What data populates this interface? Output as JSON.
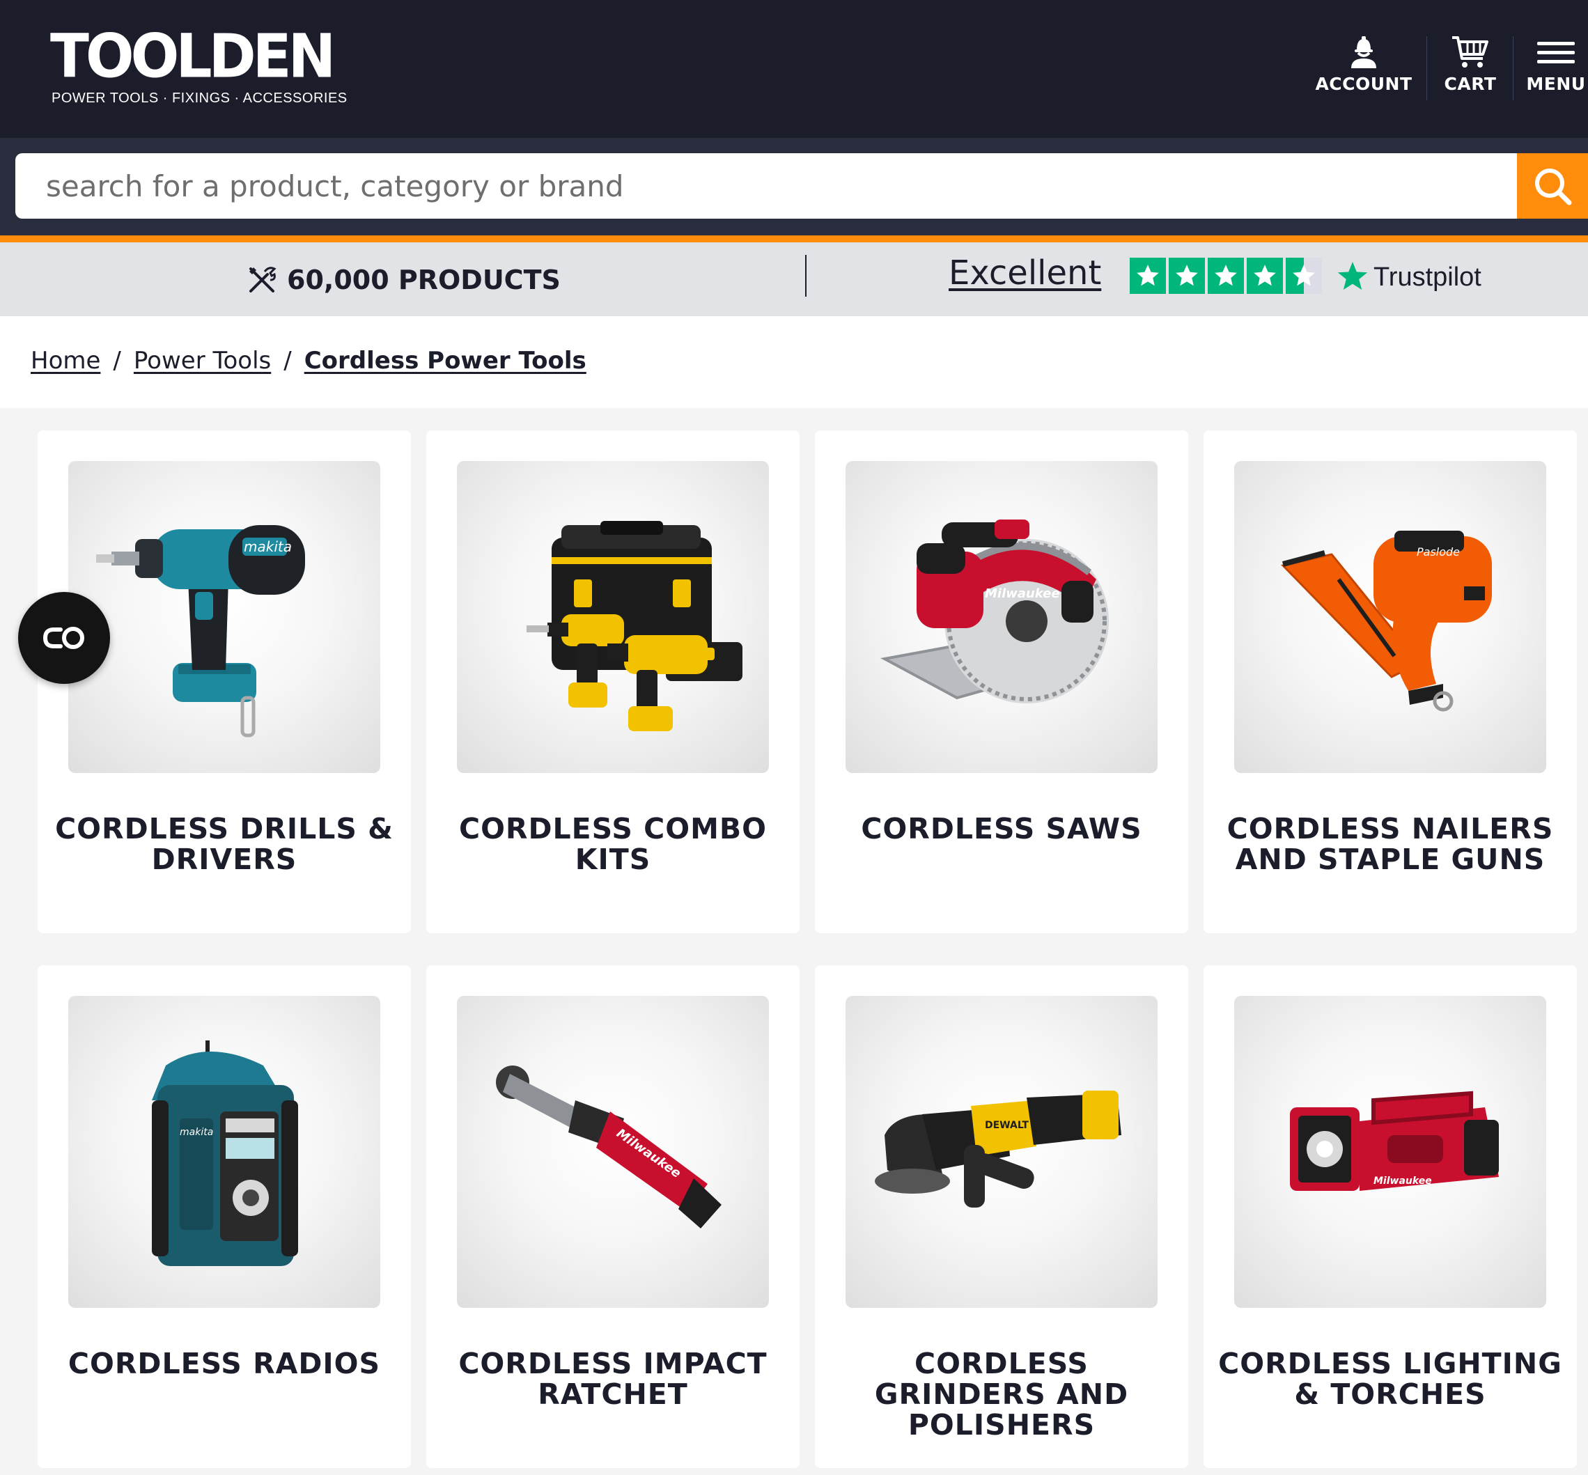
{
  "brand": {
    "name": "TOOLDEN",
    "tagline": "POWER TOOLS · FIXINGS · ACCESSORIES"
  },
  "nav": {
    "account_label": "ACCOUNT",
    "cart_label": "CART",
    "menu_label": "MENU"
  },
  "search": {
    "placeholder": "search for a product, category or brand"
  },
  "info_bar": {
    "products_label": "60,000 PRODUCTS",
    "rating_label": "Excellent",
    "rating_stars": 4.5,
    "trustpilot_label": "Trustpilot"
  },
  "breadcrumb": {
    "items": [
      {
        "label": "Home"
      },
      {
        "label": "Power Tools"
      },
      {
        "label": "Cordless Power Tools"
      }
    ],
    "separator": "/"
  },
  "categories": [
    {
      "title": "CORDLESS DRILLS & DRIVERS",
      "icon": "drill-image"
    },
    {
      "title": "CORDLESS COMBO KITS",
      "icon": "combo-kit-image"
    },
    {
      "title": "CORDLESS SAWS",
      "icon": "circular-saw-image"
    },
    {
      "title": "CORDLESS NAILERS AND STAPLE GUNS",
      "icon": "nailer-image"
    },
    {
      "title": "CORDLESS RADIOS",
      "icon": "radio-image"
    },
    {
      "title": "CORDLESS IMPACT RATCHET",
      "icon": "ratchet-image"
    },
    {
      "title": "CORDLESS GRINDERS AND POLISHERS",
      "icon": "grinder-image"
    },
    {
      "title": "CORDLESS LIGHTING & TORCHES",
      "icon": "torch-image"
    }
  ],
  "colors": {
    "header_bg": "#1b1d2b",
    "accent": "#ff8c0a",
    "trustpilot_green": "#00b67a"
  }
}
